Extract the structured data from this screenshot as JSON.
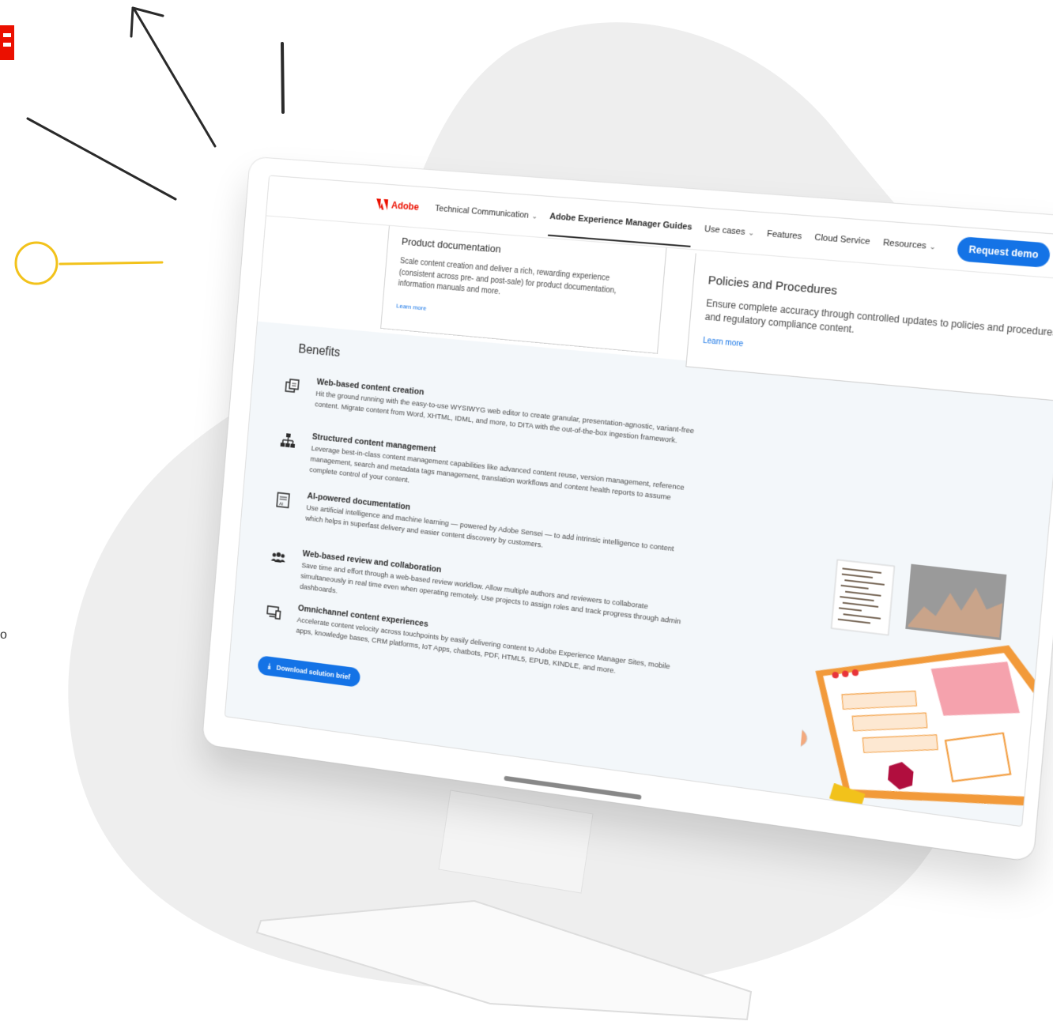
{
  "nav": {
    "logo_text": "Adobe",
    "items": [
      {
        "label": "Technical Communication",
        "has_chevron": true
      },
      {
        "label": "Adobe Experience Manager Guides",
        "active": true
      },
      {
        "label": "Use cases",
        "has_chevron": true
      },
      {
        "label": "Features"
      },
      {
        "label": "Cloud Service"
      },
      {
        "label": "Resources",
        "has_chevron": true
      }
    ],
    "cta_label": "Request demo"
  },
  "cards": [
    {
      "title": "Product documentation",
      "text": "Scale content creation and deliver a rich, rewarding experience (consistent across pre- and post-sale) for product documentation, information manuals and more.",
      "link": "Learn more"
    },
    {
      "title": "Policies and Procedures",
      "text": "Ensure complete accuracy through controlled updates to policies and procedures and regulatory compliance content.",
      "link": "Learn more"
    }
  ],
  "benefits": {
    "title": "Benefits",
    "items": [
      {
        "icon": "web-editor-icon",
        "title": "Web-based content creation",
        "text": "Hit the ground running with the easy-to-use WYSIWYG web editor to create granular, presentation-agnostic, variant-free content. Migrate content from Word, XHTML, IDML, and more, to DITA with the out-of-the-box ingestion framework."
      },
      {
        "icon": "sitemap-icon",
        "title": "Structured content management",
        "text": "Leverage best-in-class content management capabilities like advanced content reuse, version management, reference management, search and metadata tags management, translation workflows and content health reports to assume complete control of your content."
      },
      {
        "icon": "ai-document-icon",
        "title": "AI-powered documentation",
        "text": "Use artificial intelligence and machine learning — powered by Adobe Sensei — to add intrinsic intelligence to content which helps in superfast delivery and easier content discovery by customers."
      },
      {
        "icon": "users-icon",
        "title": "Web-based review and collaboration",
        "text": "Save time and effort through a web-based review workflow. Allow multiple authors and reviewers to collaborate simultaneously in real time even when operating remotely. Use projects to assign roles and track progress through admin dashboards."
      },
      {
        "icon": "devices-icon",
        "title": "Omnichannel content experiences",
        "text": "Accelerate content velocity across touchpoints by easily delivering content to Adobe Experience Manager Sites, mobile apps, knowledge bases, CRM platforms, IoT Apps, chatbots, PDF, HTML5, EPUB, KINDLE, and more."
      }
    ],
    "download_label": "Download solution brief"
  },
  "side_text": "o",
  "colors": {
    "adobe_red": "#eb1000",
    "primary_blue": "#1473e6",
    "accent_yellow": "#f2c21b",
    "illus_orange": "#f29a3a",
    "illus_pink": "#f5a2ad"
  }
}
